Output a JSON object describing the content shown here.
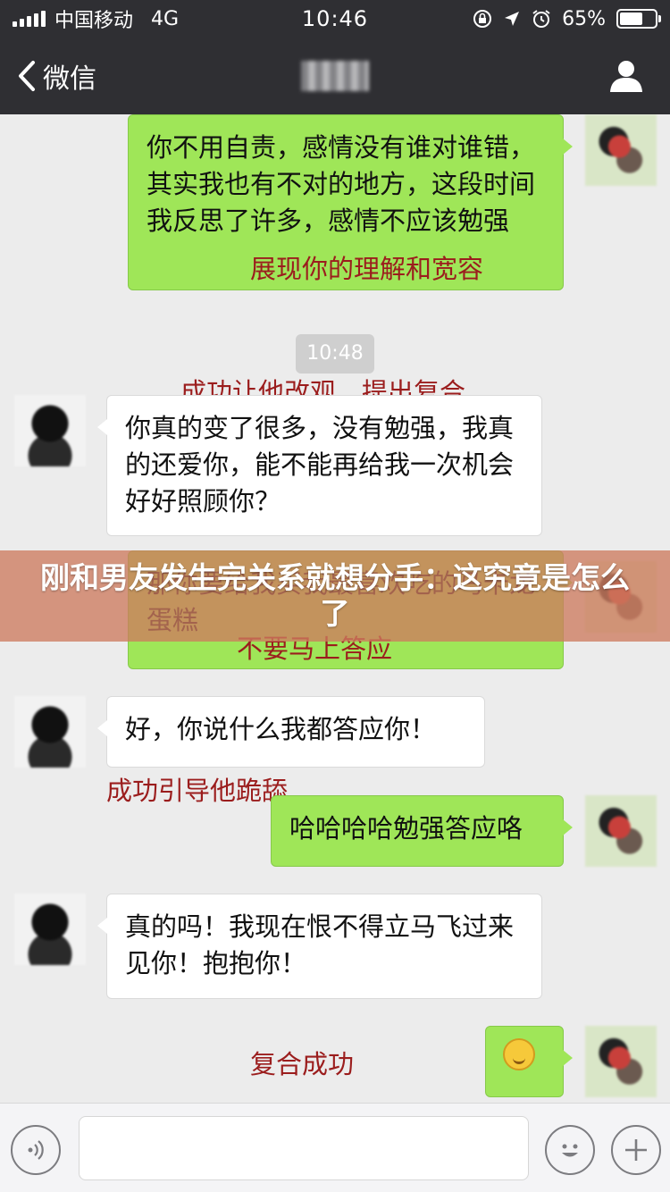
{
  "status_bar": {
    "carrier": "中国移动",
    "network": "4G",
    "time": "10:46",
    "battery_percent_text": "65%",
    "battery_level": 0.65
  },
  "nav": {
    "back_label": "微信"
  },
  "chat": {
    "timestamp": "10:48",
    "messages": [
      {
        "from": "me",
        "text": "你不用自责，感情没有谁对谁错，其实我也有不对的地方，这段时间我反思了许多，感情不应该勉强"
      },
      {
        "from": "friend",
        "text": "你真的变了很多，没有勉强，我真的还爱你，能不能再给我一次机会好好照顾你？"
      },
      {
        "from": "me",
        "text": "那你要给我买我最喜欢吃的马卡龙蛋糕"
      },
      {
        "from": "friend",
        "text": "好，你说什么我都答应你！"
      },
      {
        "from": "me",
        "text": "哈哈哈哈勉强答应咯"
      },
      {
        "from": "friend",
        "text": "真的吗！我现在恨不得立马飞过来见你！抱抱你！"
      },
      {
        "from": "me",
        "text": "",
        "emoji": "grin-emoji"
      }
    ]
  },
  "annotations": [
    "展现你的理解和宽容",
    "成功让他改观，提出复合",
    "不要马上答应",
    "成功引导他跪舔",
    "复合成功"
  ],
  "overlay_title": "刚和男友发生完关系就想分手：这究竟是怎么了",
  "colors": {
    "my_bubble": "#9fe658",
    "friend_bubble": "#ffffff",
    "annotation_text": "#9b1d1d",
    "topbar": "#2f2f33"
  }
}
